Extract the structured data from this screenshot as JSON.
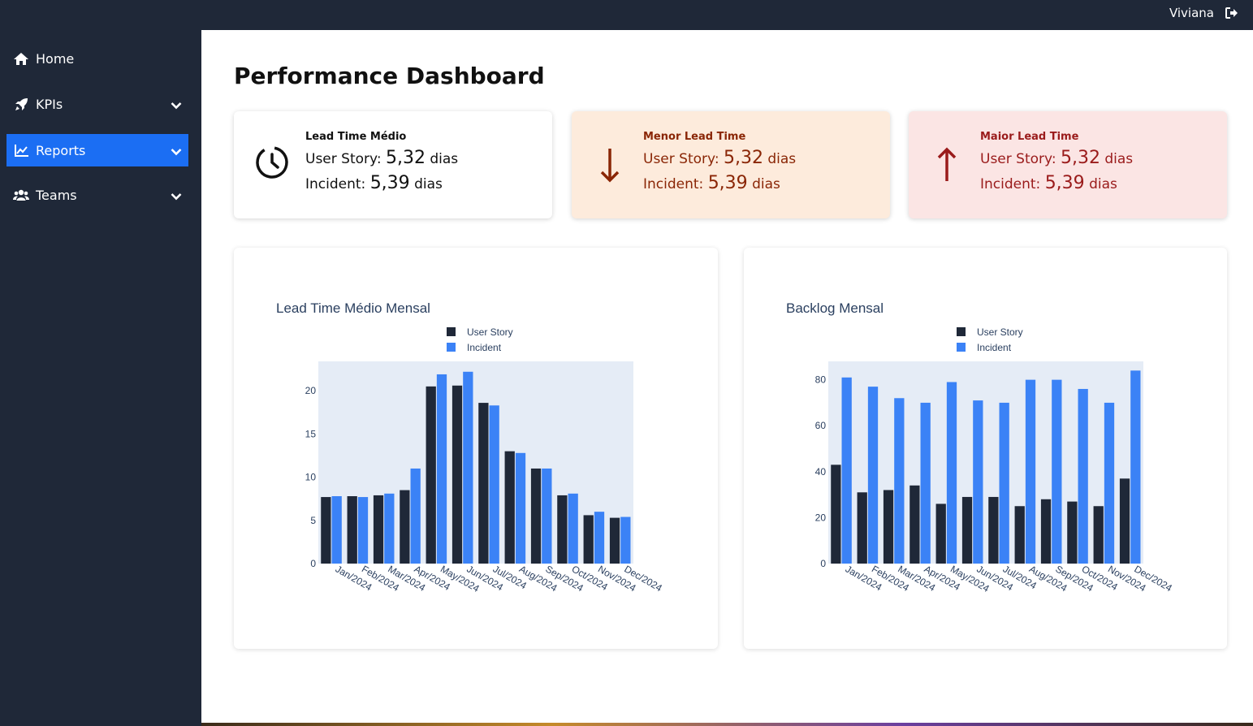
{
  "topbar": {
    "user_name": "Viviana",
    "logout_icon": "sign-out-icon"
  },
  "sidebar": {
    "items": [
      {
        "label": "Home",
        "icon": "home-icon",
        "has_chevron": false,
        "active": false
      },
      {
        "label": "KPIs",
        "icon": "rocket-icon",
        "has_chevron": true,
        "active": false
      },
      {
        "label": "Reports",
        "icon": "chart-line-icon",
        "has_chevron": true,
        "active": true
      },
      {
        "label": "Teams",
        "icon": "users-icon",
        "has_chevron": true,
        "active": false
      }
    ]
  },
  "page": {
    "title": "Performance Dashboard"
  },
  "cards": [
    {
      "label": "Lead Time Médio",
      "icon": "clock-icon",
      "us_label": "User Story:",
      "us_value": "5,32",
      "us_unit": "dias",
      "inc_label": "Incident:",
      "inc_value": "5,39",
      "inc_unit": "dias"
    },
    {
      "label": "Menor Lead Time",
      "icon": "arrow-down-icon",
      "us_label": "User Story:",
      "us_value": "5,32",
      "us_unit": "dias",
      "inc_label": "Incident:",
      "inc_value": "5,39",
      "inc_unit": "dias"
    },
    {
      "label": "Maior Lead Time",
      "icon": "arrow-up-icon",
      "us_label": "User Story:",
      "us_value": "5,32",
      "us_unit": "dias",
      "inc_label": "Incident:",
      "inc_value": "5,39",
      "inc_unit": "dias"
    }
  ],
  "colors": {
    "sidebar_bg": "#1f2838",
    "active_item": "#1b6ef3",
    "series_user_story": "#1f2838",
    "series_incident": "#3b82f6",
    "plot_bg": "#e5ecf6"
  },
  "chart_data": [
    {
      "type": "bar",
      "title": "Lead Time Médio Mensal",
      "categories": [
        "Jan/2024",
        "Feb/2024",
        "Mar/2024",
        "Apr/2024",
        "May/2024",
        "Jun/2024",
        "Jul/2024",
        "Aug/2024",
        "Sep/2024",
        "Oct/2024",
        "Nov/2024",
        "Dec/2024"
      ],
      "series": [
        {
          "name": "User Story",
          "values": [
            7.7,
            7.8,
            7.9,
            8.5,
            20.5,
            20.6,
            18.6,
            13.0,
            11.0,
            7.9,
            5.6,
            5.3
          ]
        },
        {
          "name": "Incident",
          "values": [
            7.8,
            7.7,
            8.1,
            11.0,
            21.9,
            22.2,
            18.3,
            12.8,
            11.0,
            8.1,
            6.0,
            5.4
          ]
        }
      ],
      "y_ticks": [
        0,
        5,
        10,
        15,
        20
      ],
      "ylim": [
        0,
        23.4
      ],
      "legend": "top-center",
      "grid": false
    },
    {
      "type": "bar",
      "title": "Backlog Mensal",
      "categories": [
        "Jan/2024",
        "Feb/2024",
        "Mar/2024",
        "Apr/2024",
        "May/2024",
        "Jun/2024",
        "Jul/2024",
        "Aug/2024",
        "Sep/2024",
        "Oct/2024",
        "Nov/2024",
        "Dec/2024"
      ],
      "series": [
        {
          "name": "User Story",
          "values": [
            43,
            31,
            32,
            34,
            26,
            29,
            29,
            25,
            28,
            27,
            25,
            37
          ]
        },
        {
          "name": "Incident",
          "values": [
            81,
            77,
            72,
            70,
            79,
            71,
            70,
            80,
            80,
            76,
            70,
            84
          ]
        }
      ],
      "y_ticks": [
        0,
        20,
        40,
        60,
        80
      ],
      "ylim": [
        0,
        88
      ],
      "legend": "top-center",
      "grid": false
    }
  ]
}
